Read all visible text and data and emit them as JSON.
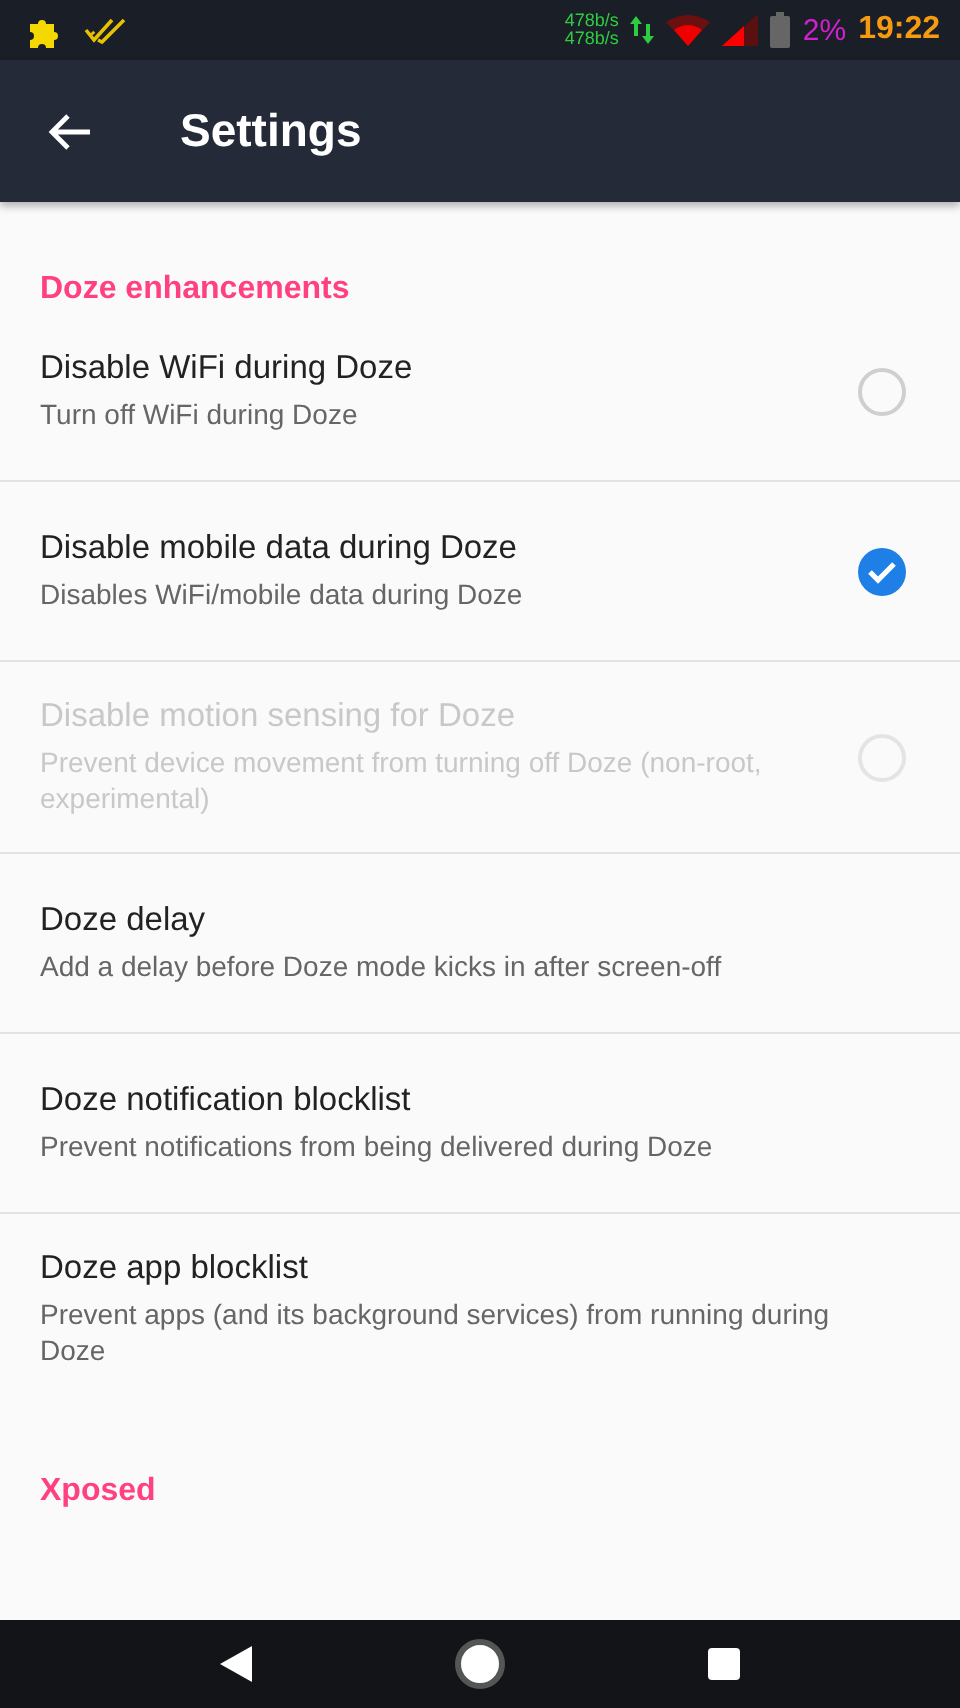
{
  "status_bar": {
    "net_up": "478b/s",
    "net_down": "478b/s",
    "battery": "2%",
    "time": "19:22"
  },
  "app_bar": {
    "title": "Settings"
  },
  "sections": [
    {
      "title": "Doze enhancements",
      "items": [
        {
          "kind": "check",
          "title": "Disable WiFi during Doze",
          "summary": "Turn off WiFi during Doze",
          "checked": false,
          "disabled": false
        },
        {
          "kind": "check",
          "title": "Disable mobile data during Doze",
          "summary": "Disables WiFi/mobile data during Doze",
          "checked": true,
          "disabled": false
        },
        {
          "kind": "check",
          "title": "Disable motion sensing for Doze",
          "summary": "Prevent device movement from turning off Doze (non-root, experimental)",
          "checked": false,
          "disabled": true
        },
        {
          "kind": "plain",
          "title": "Doze delay",
          "summary": "Add a delay before Doze mode kicks in after screen-off",
          "disabled": false
        },
        {
          "kind": "plain",
          "title": "Doze notification blocklist",
          "summary": "Prevent notifications from being delivered during Doze",
          "disabled": false
        },
        {
          "kind": "plain",
          "title": "Doze app blocklist",
          "summary": "Prevent apps (and its background services) from running during Doze",
          "disabled": false
        }
      ]
    },
    {
      "title": "Xposed"
    }
  ]
}
